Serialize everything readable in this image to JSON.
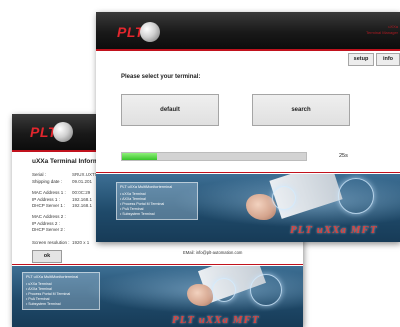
{
  "back_window": {
    "logo_text": "PLT",
    "panel_title": "uXXa Terminal Informati",
    "group1": [
      {
        "label": "Serial :",
        "value": "SRUX.UXT0"
      },
      {
        "label": "Shipping date :",
        "value": "09.01.201"
      }
    ],
    "group2": [
      {
        "label": "MAC Address 1 :",
        "value": "00:0C:29"
      },
      {
        "label": "IP Address 1 :",
        "value": "192.168.1"
      },
      {
        "label": "DHCP Server 1 :",
        "value": "192.168.1"
      }
    ],
    "group3": [
      {
        "label": "MAC Address 2 :",
        "value": ""
      },
      {
        "label": "IP Address 2 :",
        "value": ""
      },
      {
        "label": "DHCP Server 2 :",
        "value": ""
      }
    ],
    "resolution": {
      "label": "Screen resolution :",
      "value": "1920 x 1"
    },
    "ok_label": "ok",
    "email": "EMail: info@plt-automation.com",
    "banner": {
      "box_title": "PLT uXXa MultiMonitorterminal",
      "items": [
        "uXXa Terminal",
        "AXXa Terminal",
        "Process Portal M Terminal",
        "PoA Terminal",
        "Subsystem Terminal"
      ],
      "caption": "PLT uXXa MFT"
    }
  },
  "front_window": {
    "logo_text": "PLT",
    "brand_lines": [
      "uXXa",
      "Terminal Manager"
    ],
    "setup_label": "setup",
    "info_label": "info",
    "prompt": "Please select your terminal:",
    "default_label": "default",
    "search_label": "search",
    "progress": {
      "fraction": 0.19,
      "time_label": "25s"
    },
    "email": "EMail: info@plt-automation.com",
    "banner": {
      "box_title": "PLT uXXa MultiMonitorterminal",
      "items": [
        "uXXa Terminal",
        "AXXa Terminal",
        "Process Portal M Terminal",
        "PoA Terminal",
        "Subsystem Terminal"
      ],
      "caption": "PLT uXXa MFT"
    }
  },
  "colors": {
    "brand_red": "#e3262d",
    "progress_green": "#38c42a",
    "banner_blue": "#2a5a80"
  }
}
